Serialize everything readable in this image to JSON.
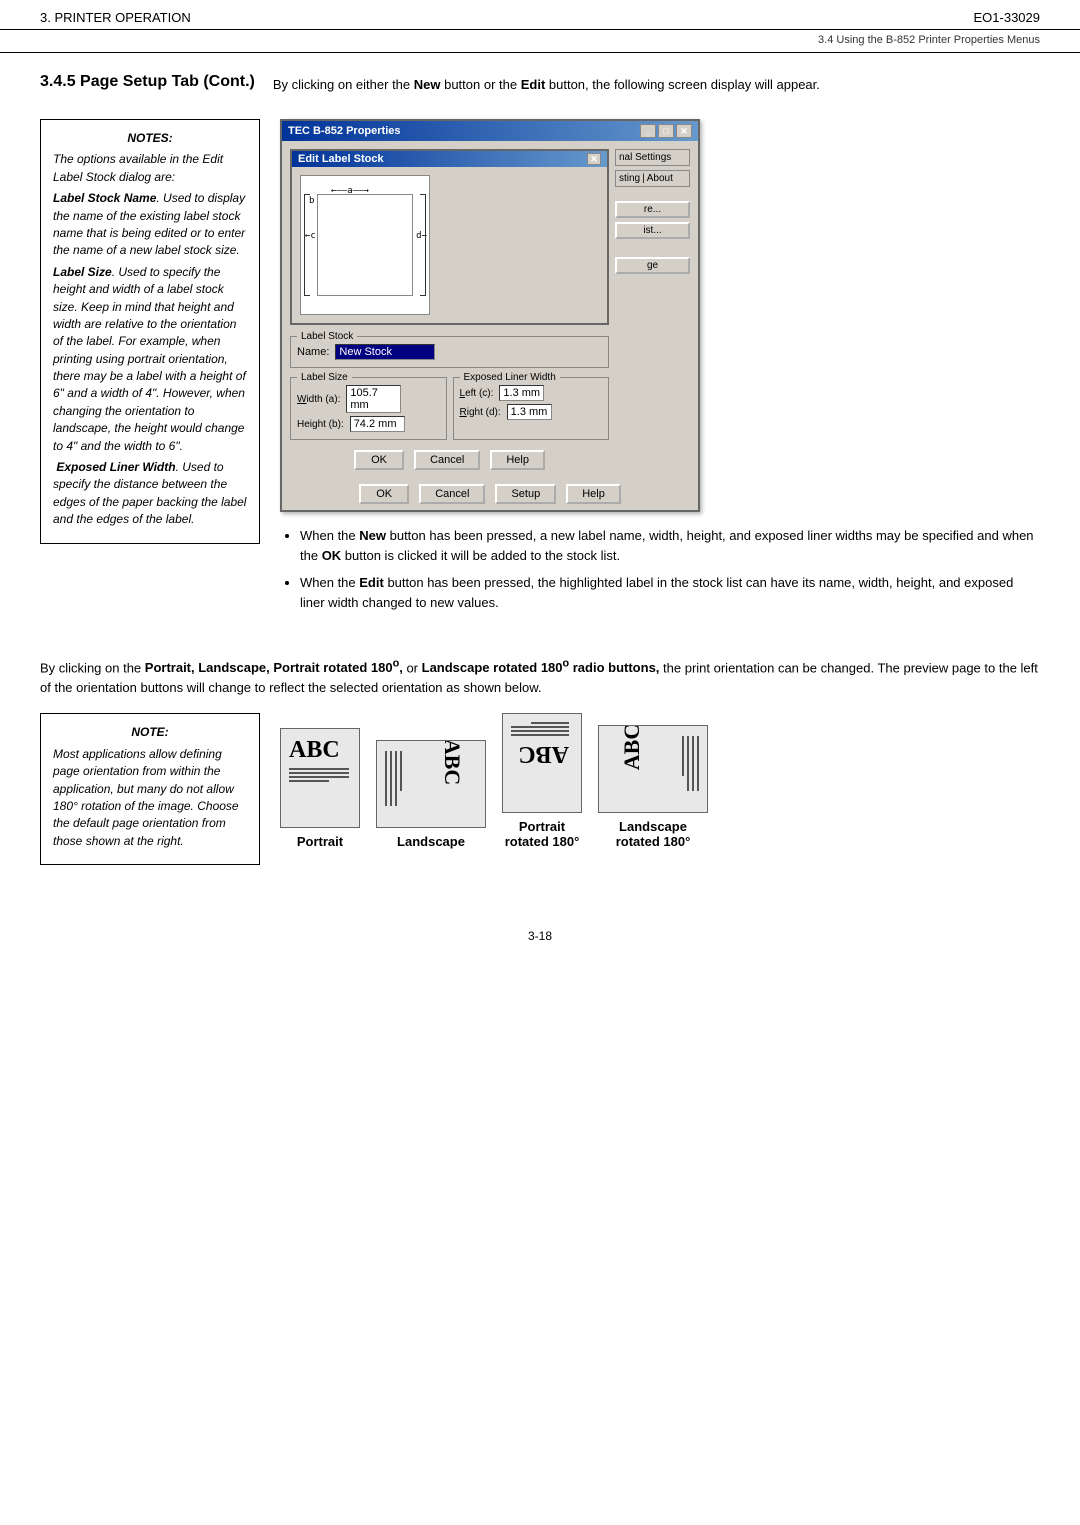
{
  "header": {
    "left": "3. PRINTER OPERATION",
    "right": "EO1-33029",
    "subheader": "3.4 Using the B-852 Printer Properties Menus"
  },
  "section": {
    "title": "3.4.5  Page Setup Tab (Cont.)",
    "intro": "By clicking on either the New button or the Edit button, the following screen display will appear."
  },
  "notes_box": {
    "title": "NOTES:",
    "paragraphs": [
      "The options available in the Edit Label Stock dialog are:",
      "Label Stock Name. Used to display the name of the existing label stock name that is being edited or to enter the name of a new label stock size.",
      "Label Size. Used to specify the height and width of a label stock size. Keep in mind that height and width are relative to the orientation of the label. For example, when printing using portrait orientation, there may be a label with a height of 6\" and a width of 4\". However, when changing the orientation to landscape, the height would change to 4\" and the width to 6\".",
      "Exposed Liner Width. Used to specify the distance between the edges of the paper backing the label and the edges of the label."
    ]
  },
  "note_box2": {
    "title": "NOTE:",
    "paragraphs": [
      "Most applications allow defining page orientation from within the application, but many do not allow 180° rotation of the image. Choose the default page orientation from those shown at the right."
    ]
  },
  "dialog": {
    "title": "TEC B-852 Properties",
    "inner_title": "Edit Label Stock",
    "tabs": [
      "nal Settings",
      "sting",
      "About"
    ],
    "buttons_right": [
      "re...",
      "ist...",
      "ge"
    ],
    "label_stock_section": "Label Stock",
    "name_label": "Name:",
    "name_value": "New Stock",
    "label_size_legend": "Label Size",
    "exposed_liner_legend": "Exposed Liner Width",
    "width_label": "Width (a):",
    "width_value": "105.7 mm",
    "left_label": "Left (c):",
    "left_value": "1.3 mm",
    "height_label": "Height (b):",
    "height_value": "74.2 mm",
    "right_label": "Right (d):",
    "right_value": "1.3 mm",
    "btn_ok": "OK",
    "btn_cancel": "Cancel",
    "btn_help": "Help",
    "btn_help2": "Help"
  },
  "bullets": [
    "When the New button has been pressed, a new label name, width, height, and exposed liner widths may be specified and when the OK button is clicked it will be added to the stock list.",
    "When the Edit button has been pressed, the highlighted label in the stock list can have its name, width, height, and exposed liner width changed to new values."
  ],
  "orientation_text": "By clicking on the Portrait, Landscape, Portrait rotated 180°, or Landscape rotated 180° radio buttons, the print orientation can be changed. The preview page to the left of the orientation buttons will change to reflect the selected orientation as shown below.",
  "orientations": [
    {
      "label": "Portrait",
      "type": "portrait"
    },
    {
      "label": "Landscape",
      "type": "landscape"
    },
    {
      "label": "Portrait\nrotated 180°",
      "type": "portrait-rotated"
    },
    {
      "label": "Landscape\nrotated 180°",
      "type": "landscape-rotated"
    }
  ],
  "footer": {
    "page": "3-18"
  }
}
